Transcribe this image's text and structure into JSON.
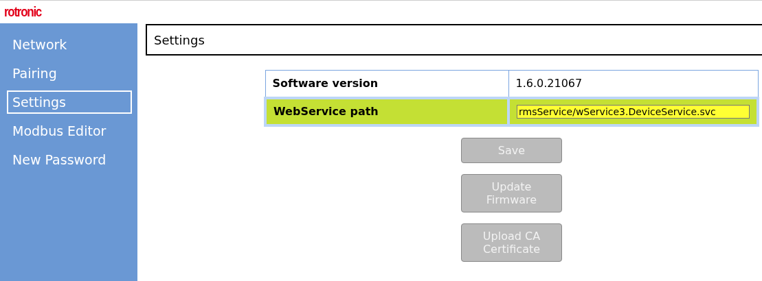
{
  "logo": "rotronic",
  "sidebar": {
    "items": [
      {
        "label": "Network",
        "selected": false
      },
      {
        "label": "Pairing",
        "selected": false
      },
      {
        "label": "Settings",
        "selected": true
      },
      {
        "label": "Modbus Editor",
        "selected": false
      },
      {
        "label": "New Password",
        "selected": false
      }
    ]
  },
  "page_title": "Settings",
  "table": {
    "rows": [
      {
        "kind": "text",
        "label": "Software version",
        "value": "1.6.0.21067",
        "highlighted": false
      },
      {
        "kind": "input",
        "label": "WebService path",
        "value": "rmsService/wService3.DeviceService.svc",
        "highlighted": true
      }
    ]
  },
  "buttons": [
    {
      "label": "Save",
      "disabled": true
    },
    {
      "label": "Update Firmware",
      "disabled": true
    },
    {
      "label": "Upload CA Certificate",
      "disabled": true
    }
  ]
}
